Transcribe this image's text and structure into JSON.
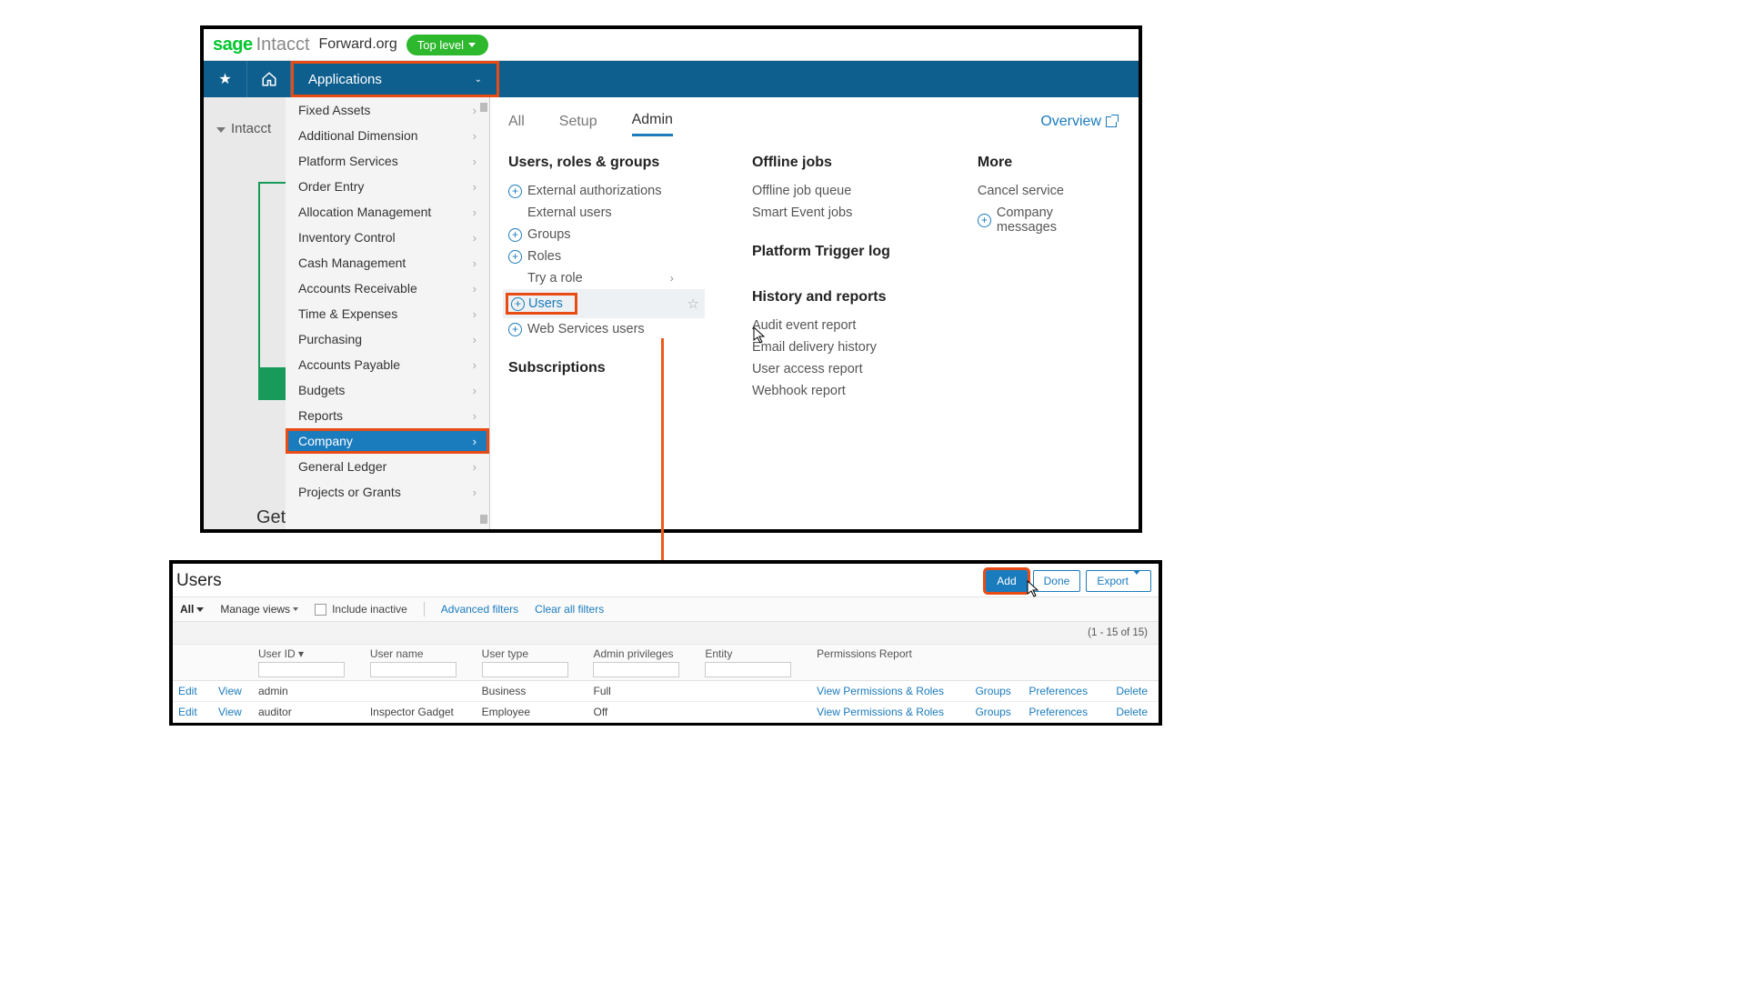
{
  "header": {
    "brand_sage": "sage",
    "brand_intacct": "Intacct",
    "company": "Forward.org",
    "top_level": "Top level"
  },
  "navbar": {
    "applications": "Applications"
  },
  "background": {
    "crumb": "Intacct",
    "get": "Get"
  },
  "sidebar": {
    "items": [
      "Fixed Assets",
      "Additional Dimension",
      "Platform Services",
      "Order Entry",
      "Allocation Management",
      "Inventory Control",
      "Cash Management",
      "Accounts Receivable",
      "Time & Expenses",
      "Purchasing",
      "Accounts Payable",
      "Budgets",
      "Reports",
      "Company",
      "General Ledger",
      "Projects or Grants"
    ],
    "selected_index": 13
  },
  "mega": {
    "tabs": {
      "all": "All",
      "setup": "Setup",
      "admin": "Admin"
    },
    "overview": "Overview",
    "col1": {
      "h1": "Users, roles & groups",
      "external_auth": "External authorizations",
      "external_users": "External users",
      "groups": "Groups",
      "roles": "Roles",
      "try_role": "Try a role",
      "users": "Users",
      "web_services": "Web Services users",
      "h2": "Subscriptions"
    },
    "col2": {
      "h1": "Offline jobs",
      "offline_queue": "Offline job queue",
      "smart_event": "Smart Event jobs",
      "h2": "Platform Trigger log",
      "h3": "History and reports",
      "audit": "Audit event report",
      "email": "Email delivery history",
      "user_access": "User access report",
      "webhook": "Webhook report"
    },
    "col3": {
      "h1": "More",
      "cancel": "Cancel service",
      "messages": "Company messages"
    }
  },
  "shot2": {
    "title": "Users",
    "buttons": {
      "add": "Add",
      "done": "Done",
      "export": "Export"
    },
    "toolbar": {
      "all": "All",
      "manage": "Manage views",
      "include_inactive": "Include inactive",
      "adv": "Advanced filters",
      "clear": "Clear all filters"
    },
    "count": "(1 - 15 of 15)",
    "columns": {
      "user_id": "User ID",
      "user_name": "User name",
      "user_type": "User type",
      "admin_priv": "Admin privileges",
      "entity": "Entity",
      "perm_report": "Permissions Report"
    },
    "row_actions": {
      "edit": "Edit",
      "view": "View",
      "perms": "View Permissions & Roles",
      "groups": "Groups",
      "prefs": "Preferences",
      "delete": "Delete"
    },
    "rows": [
      {
        "user_id": "admin",
        "user_name": "",
        "user_type": "Business",
        "admin_priv": "Full",
        "entity": ""
      },
      {
        "user_id": "auditor",
        "user_name": "Inspector Gadget",
        "user_type": "Employee",
        "admin_priv": "Off",
        "entity": ""
      }
    ]
  }
}
